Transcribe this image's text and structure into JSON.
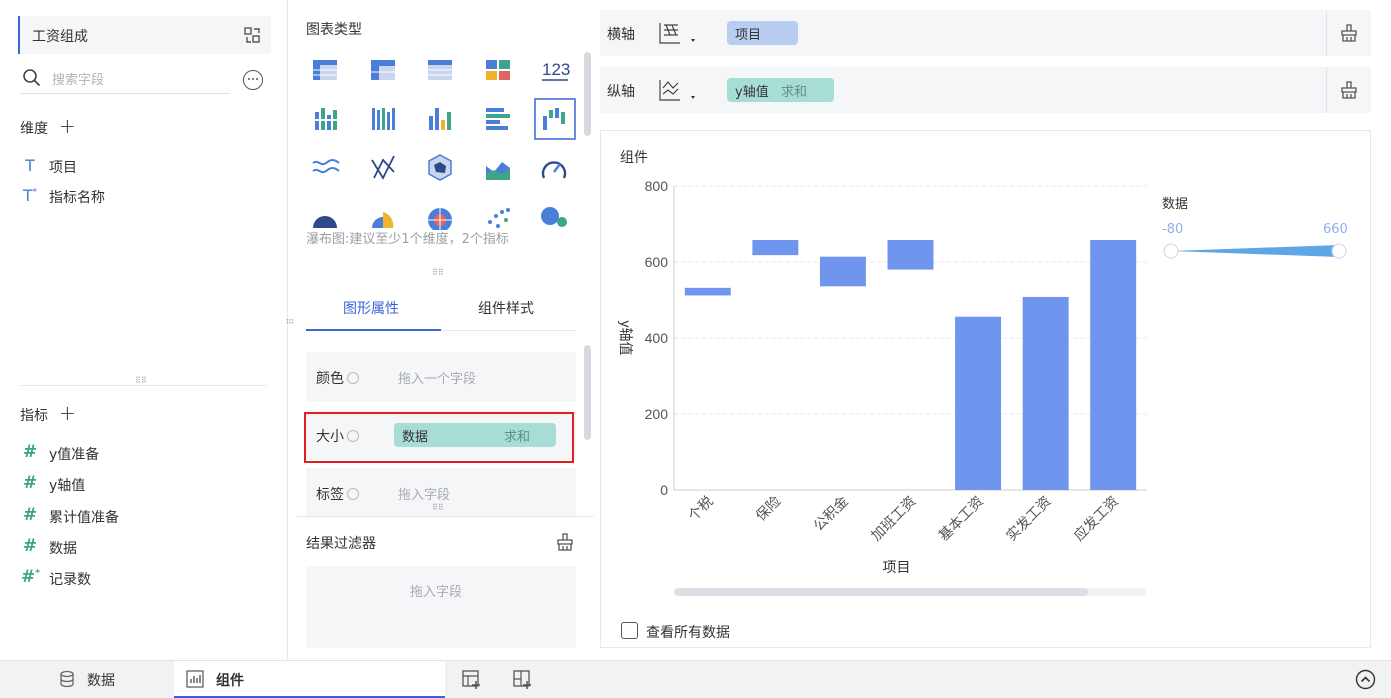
{
  "left": {
    "dataset_name": "工资组成",
    "search_placeholder": "搜索字段",
    "dimensions_label": "维度",
    "dimensions": [
      "项目",
      "指标名称"
    ],
    "measures_label": "指标",
    "measures": [
      "y值准备",
      "y轴值",
      "累计值准备",
      "数据",
      "记录数"
    ]
  },
  "middle": {
    "chart_type_title": "图表类型",
    "chart_hint": "瀑布图:建议至少1个维度，2个指标",
    "tabs": [
      "图形属性",
      "组件样式"
    ],
    "props": {
      "color_label": "颜色",
      "color_placeholder": "拖入一个字段",
      "size_label": "大小",
      "size_field": "数据",
      "size_agg": "求和",
      "label_label": "标签",
      "label_placeholder": "拖入字段"
    },
    "filter_title": "结果过滤器",
    "filter_placeholder": "拖入字段"
  },
  "right": {
    "x_axis_label": "横轴",
    "x_axis_field": "项目",
    "y_axis_label": "纵轴",
    "y_axis_field": "y轴值",
    "y_axis_agg": "求和",
    "component_title": "组件",
    "legend_title": "数据",
    "legend_min": "-80",
    "legend_max": "660",
    "view_all_label": "查看所有数据"
  },
  "chart_data": {
    "type": "bar",
    "subtype": "waterfall",
    "xlabel": "项目",
    "ylabel": "y轴值",
    "ylim": [
      0,
      800
    ],
    "yticks": [
      "800",
      "600",
      "400",
      "200",
      "0"
    ],
    "categories": [
      "个税",
      "保险",
      "公积金",
      "加班工资",
      "基本工资",
      "实发工资",
      "应发工资"
    ],
    "bars": [
      {
        "low": 512,
        "high": 532
      },
      {
        "low": 618,
        "high": 658
      },
      {
        "low": 536,
        "high": 614
      },
      {
        "low": 580,
        "high": 658
      },
      {
        "low": 0,
        "high": 456
      },
      {
        "low": 0,
        "high": 508
      },
      {
        "low": 0,
        "high": 658
      }
    ],
    "bar_color": "#6f95ee",
    "grid": true
  },
  "bottom": {
    "tab_data": "数据",
    "tab_component": "组件"
  },
  "colors": {
    "accent": "#3b64d8",
    "pill_blue": "#b9cdf0",
    "pill_teal": "#a8ddd6",
    "highlight_red": "#e02020"
  }
}
